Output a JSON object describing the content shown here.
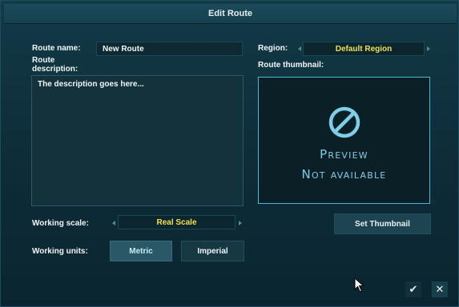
{
  "window": {
    "title": "Edit Route"
  },
  "route_name": {
    "label": "Route name:",
    "value": "New Route"
  },
  "route_description": {
    "label_line1": "Route",
    "label_line2": "description:",
    "value": "The description goes here..."
  },
  "region": {
    "label": "Region:",
    "value": "Default Region"
  },
  "thumbnail": {
    "label": "Route thumbnail:",
    "preview_line1": "Preview",
    "preview_line2": "Not available",
    "set_button": "Set Thumbnail",
    "icon": "no-preview-icon"
  },
  "working_scale": {
    "label": "Working scale:",
    "value": "Real Scale"
  },
  "working_units": {
    "label": "Working units:",
    "options": [
      "Metric",
      "Imperial"
    ],
    "selected": "Metric"
  },
  "actions": {
    "ok_icon": "✔",
    "cancel_icon": "✕"
  },
  "colors": {
    "accent_yellow": "#f0e050",
    "preview_blue": "#7fcde6",
    "thumb_border": "#4fb6d6"
  }
}
